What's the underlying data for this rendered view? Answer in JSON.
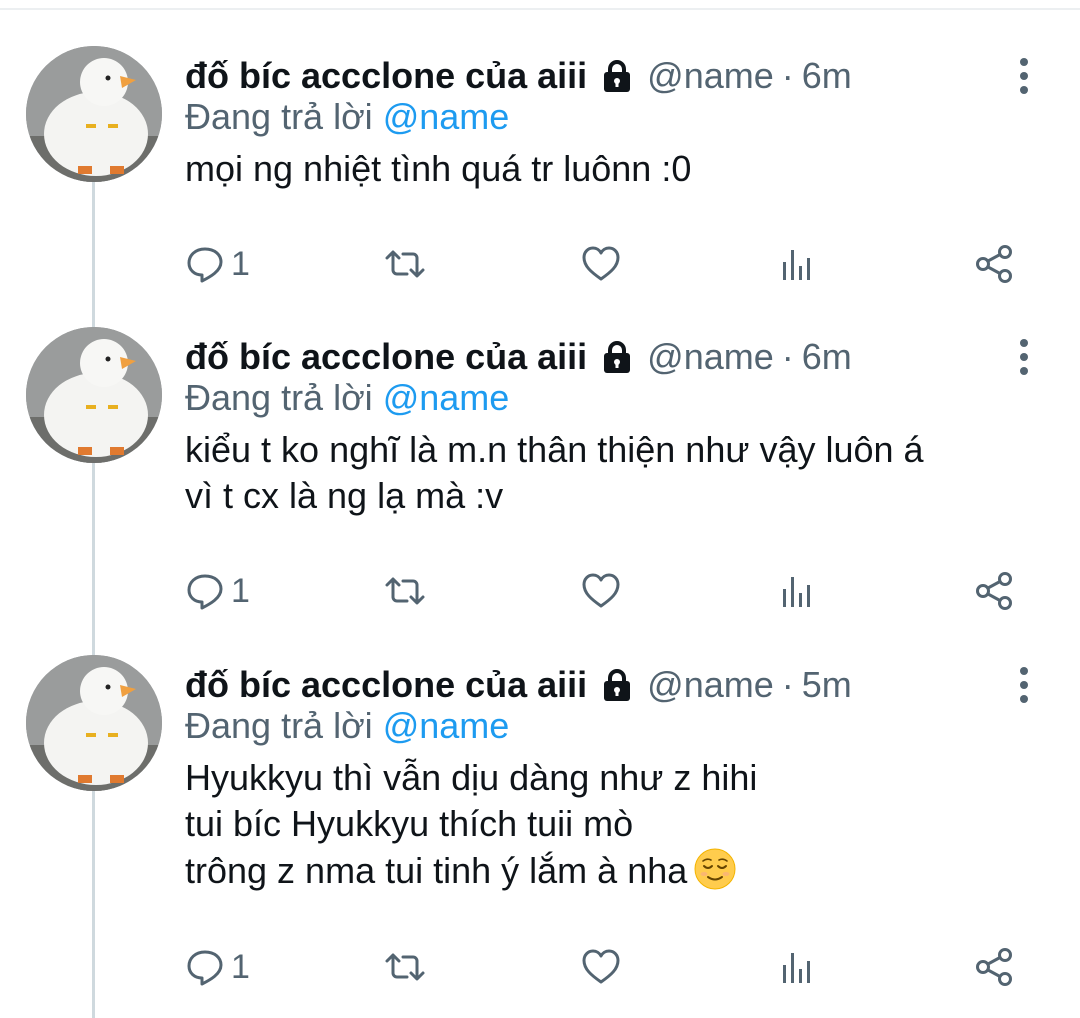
{
  "tweets": [
    {
      "display_name": "đố bíc accclone của aiii",
      "handle": "@name",
      "separator": "·",
      "time": "6m",
      "replying_prefix": "Đang trả lời",
      "replying_to": "@name",
      "text": "mọi ng nhiệt tình quá tr luônn :0",
      "emoji": "",
      "reply_count": "1"
    },
    {
      "display_name": "đố bíc accclone của aiii",
      "handle": "@name",
      "separator": "·",
      "time": "6m",
      "replying_prefix": "Đang trả lời",
      "replying_to": "@name",
      "text": "kiểu t ko nghĩ là m.n thân thiện  như vậy luôn á\nvì t cx là ng lạ mà :v",
      "emoji": "",
      "reply_count": "1"
    },
    {
      "display_name": "đố bíc accclone của aiii",
      "handle": "@name",
      "separator": "·",
      "time": "5m",
      "replying_prefix": "Đang trả lời",
      "replying_to": "@name",
      "text": "Hyukkyu thì vẫn dịu dàng như z hihi\ntui bíc Hyukkyu thích tuii mò\ntrông z nma tui tinh ý lắm à nha",
      "emoji": "relieved-face",
      "reply_count": "1"
    }
  ],
  "icons": {
    "lock": "lock-icon",
    "more": "more-vertical-icon",
    "reply": "reply-bubble-icon",
    "retweet": "retweet-icon",
    "like": "heart-icon",
    "analytics": "analytics-icon",
    "share": "share-icon"
  },
  "colors": {
    "text": "#0f1419",
    "muted": "#536471",
    "link": "#1d9bf0",
    "thread_line": "#cfd9de"
  }
}
